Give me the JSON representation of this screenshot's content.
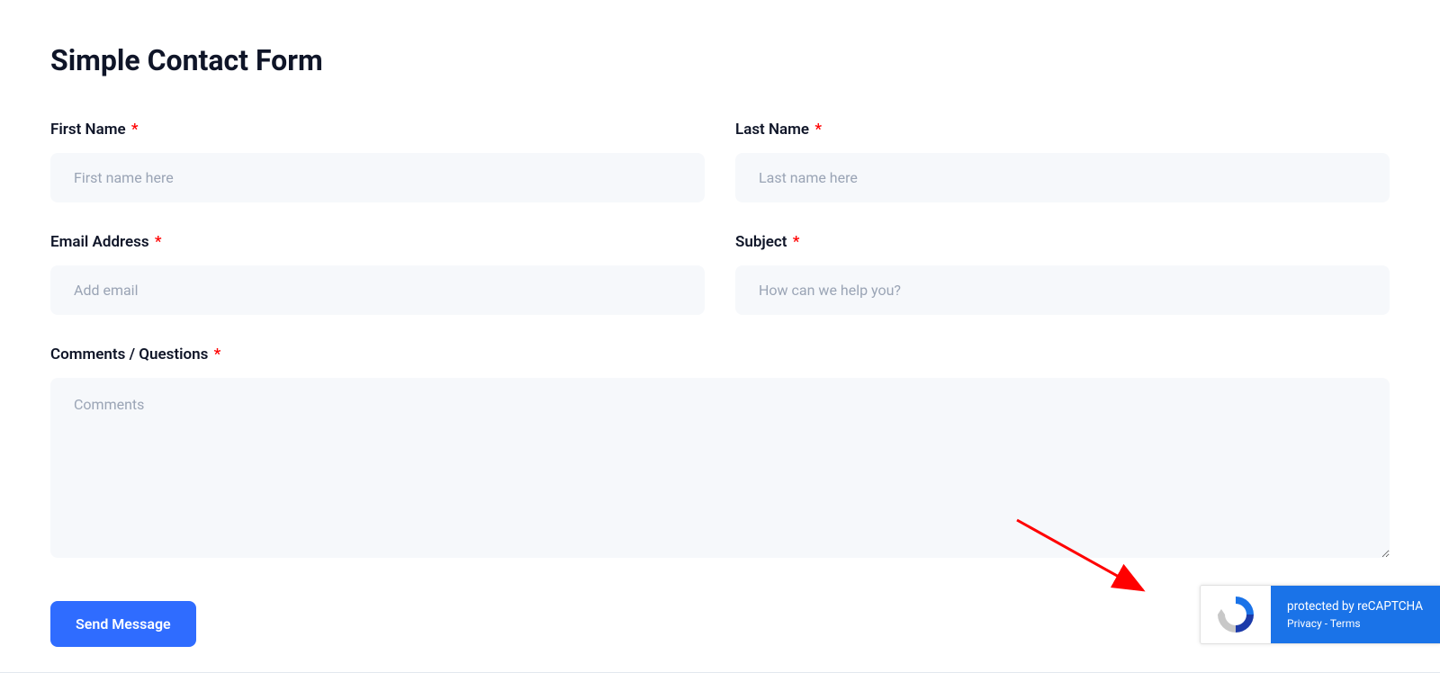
{
  "page": {
    "title": "Simple Contact Form"
  },
  "form": {
    "first_name": {
      "label": "First Name",
      "placeholder": "First name here",
      "required": true
    },
    "last_name": {
      "label": "Last Name",
      "placeholder": "Last name here",
      "required": true
    },
    "email": {
      "label": "Email Address",
      "placeholder": "Add email",
      "required": true
    },
    "subject": {
      "label": "Subject",
      "placeholder": "How can we help you?",
      "required": true
    },
    "comments": {
      "label": "Comments / Questions",
      "placeholder": "Comments",
      "required": true
    },
    "submit_label": "Send Message",
    "required_marker": "*"
  },
  "recaptcha": {
    "protected_text": "protected by reCAPTCHA",
    "privacy_label": "Privacy",
    "separator": " - ",
    "terms_label": "Terms"
  }
}
